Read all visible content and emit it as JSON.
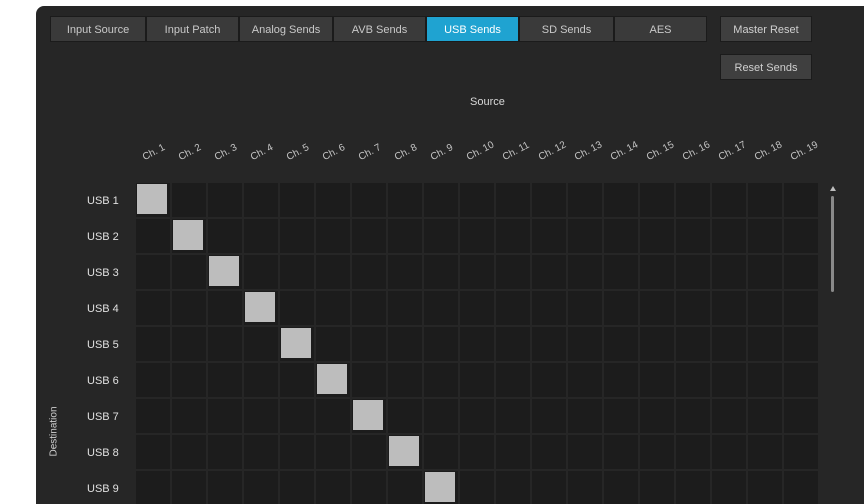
{
  "tabs": [
    {
      "label": "Input Source",
      "active": false
    },
    {
      "label": "Input Patch",
      "active": false
    },
    {
      "label": "Analog Sends",
      "active": false
    },
    {
      "label": "AVB Sends",
      "active": false
    },
    {
      "label": "USB Sends",
      "active": true
    },
    {
      "label": "SD Sends",
      "active": false
    },
    {
      "label": "AES",
      "active": false
    }
  ],
  "buttons": {
    "master_reset": "Master Reset",
    "reset_sends": "Reset Sends"
  },
  "source_label": "Source",
  "destination_label": "Destination",
  "columns": [
    "Ch. 1",
    "Ch. 2",
    "Ch. 3",
    "Ch. 4",
    "Ch. 5",
    "Ch. 6",
    "Ch. 7",
    "Ch. 8",
    "Ch. 9",
    "Ch. 10",
    "Ch. 11",
    "Ch. 12",
    "Ch. 13",
    "Ch. 14",
    "Ch. 15",
    "Ch. 16",
    "Ch. 17",
    "Ch. 18",
    "Ch. 19"
  ],
  "rows": [
    "USB 1",
    "USB 2",
    "USB 3",
    "USB 4",
    "USB 5",
    "USB 6",
    "USB 7",
    "USB 8",
    "USB 9"
  ],
  "routing": [
    [
      0,
      0
    ],
    [
      1,
      1
    ],
    [
      2,
      2
    ],
    [
      3,
      3
    ],
    [
      4,
      4
    ],
    [
      5,
      5
    ],
    [
      6,
      6
    ],
    [
      7,
      7
    ],
    [
      8,
      8
    ]
  ],
  "colors": {
    "accent": "#1fa3d1",
    "active_cell": "#bdbdbd",
    "cell": "#1c1c1c",
    "background": "#262626"
  }
}
